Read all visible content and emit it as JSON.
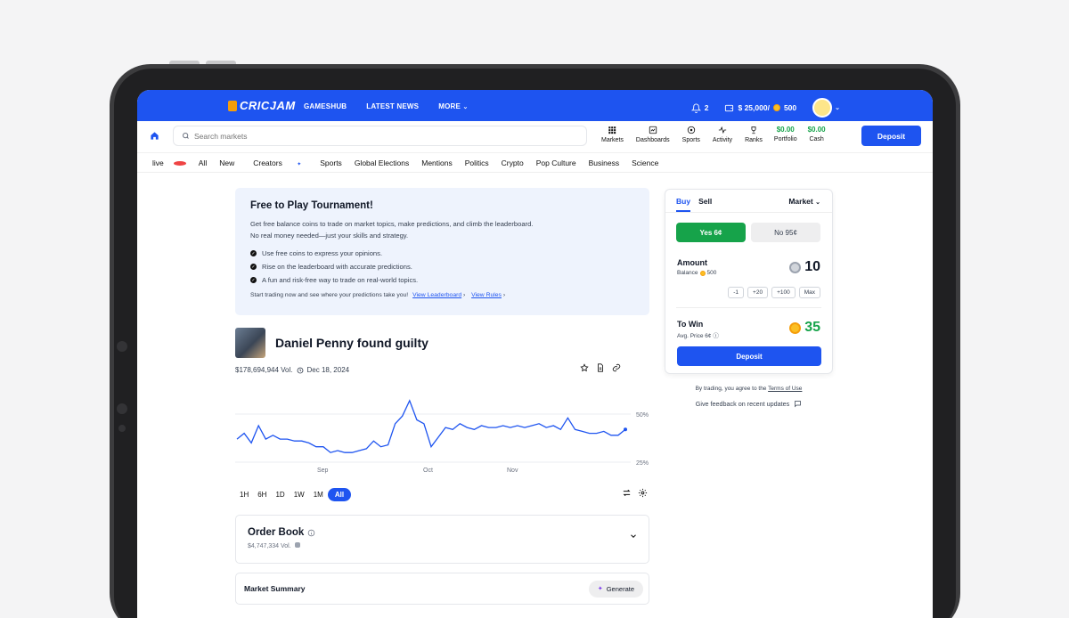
{
  "brand": {
    "name": "CRICJAM"
  },
  "topnav": [
    "GAMESHUB",
    "LATEST NEWS",
    "MORE"
  ],
  "topbar": {
    "notifications": "2",
    "balance": "$ 25,000/",
    "coins": "500"
  },
  "search": {
    "placeholder": "Search markets"
  },
  "icon_nav": [
    {
      "label": "Markets",
      "icon": "grid-icon"
    },
    {
      "label": "Dashboards",
      "icon": "dashboard-icon"
    },
    {
      "label": "Sports",
      "icon": "ball-icon"
    },
    {
      "label": "Activity",
      "icon": "pulse-icon"
    },
    {
      "label": "Ranks",
      "icon": "trophy-icon"
    }
  ],
  "portfolio": {
    "amount": "$0.00",
    "label": "Portfolio"
  },
  "cash": {
    "amount": "$0.00",
    "label": "Cash"
  },
  "deposit_label": "Deposit",
  "categories": [
    "live",
    "All",
    "New",
    "Creators",
    "Sports",
    "Global Elections",
    "Mentions",
    "Politics",
    "Crypto",
    "Pop Culture",
    "Business",
    "Science"
  ],
  "banner": {
    "title": "Free to Play Tournament!",
    "line1": "Get free balance coins to trade on market topics, make predictions, and climb the leaderboard.",
    "line2": "No real money needed—just your skills and strategy.",
    "checks": [
      "Use free coins to express your opinions.",
      "Rise on the leaderboard with accurate predictions.",
      "A fun and risk-free way to trade on real-world topics."
    ],
    "footer": "Start trading now and see where your predictions take you!",
    "link1": "View Leaderboard",
    "link2": "View Rules"
  },
  "market": {
    "title": "Daniel Penny found guilty",
    "volume": "$178,694,944 Vol.",
    "date": "Dec 18, 2024"
  },
  "chart_data": {
    "type": "line",
    "x_ticks": [
      "Sep",
      "Oct",
      "Nov"
    ],
    "y_ticks": [
      "50%",
      "25%"
    ],
    "ylim": [
      25,
      50
    ],
    "series": [
      {
        "values": [
          37,
          40,
          35,
          44,
          37,
          39,
          37,
          37,
          36,
          36,
          35,
          33,
          33,
          30,
          31,
          30,
          30,
          31,
          32,
          36,
          33,
          34,
          45,
          49,
          57,
          47,
          45,
          33,
          38,
          43,
          42,
          45,
          43,
          42,
          44,
          43,
          43,
          44,
          43,
          44,
          43,
          44,
          45,
          43,
          44,
          42,
          48,
          42,
          41,
          40,
          40,
          41,
          39,
          39,
          42
        ]
      }
    ]
  },
  "ranges": [
    "1H",
    "6H",
    "1D",
    "1W",
    "1M",
    "All"
  ],
  "orderbook": {
    "title": "Order Book",
    "volume": "$4,747,334 Vol."
  },
  "summary": {
    "title": "Market Summary",
    "button": "Generate"
  },
  "trade": {
    "buy": "Buy",
    "sell": "Sell",
    "type": "Market",
    "yes": "Yes 6¢",
    "no": "No 95¢",
    "amount_label": "Amount",
    "balance_label": "Balance",
    "balance_value": "500",
    "amount_value": "10",
    "increments": [
      "-1",
      "+20",
      "+100",
      "Max"
    ],
    "win_label": "To Win",
    "avg_price": "Avg. Price 6¢",
    "win_value": "35",
    "deposit": "Deposit"
  },
  "terms": {
    "text": "By trading, you agree to the",
    "link": "Terms of Use"
  },
  "feedback": "Give feedback on recent updates",
  "colors": {
    "accent": "#1e54f0",
    "success": "#16a34a",
    "live": "#ef4444"
  }
}
